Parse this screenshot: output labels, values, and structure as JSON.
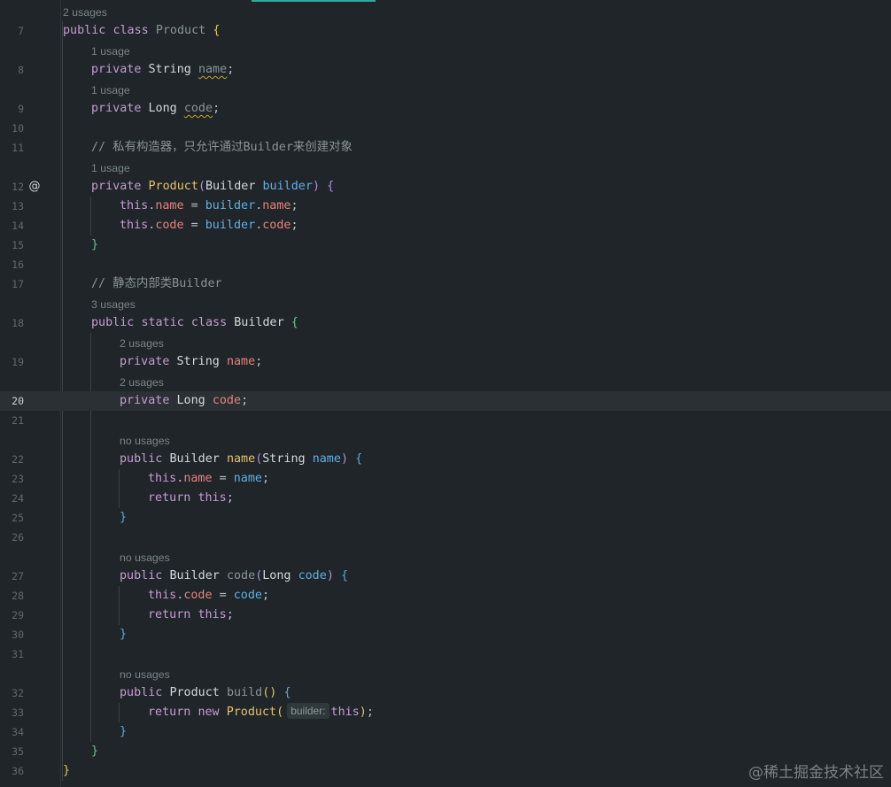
{
  "usage_hints": {
    "u_product_class": "2 usages",
    "u_name_field": "1 usage",
    "u_code_field": "1 usage",
    "u_constructor": "1 usage",
    "u_builder_class": "3 usages",
    "u_builder_name": "2 usages",
    "u_builder_code": "2 usages",
    "u_name_method": "no usages",
    "u_code_method": "no usages",
    "u_build_method": "no usages"
  },
  "line_numbers": {
    "l7": "7",
    "l8": "8",
    "l9": "9",
    "l10": "10",
    "l11": "11",
    "l12": "12",
    "l13": "13",
    "l14": "14",
    "l15": "15",
    "l16": "16",
    "l17": "17",
    "l18": "18",
    "l19": "19",
    "l20": "20",
    "l21": "21",
    "l22": "22",
    "l23": "23",
    "l24": "24",
    "l25": "25",
    "l26": "26",
    "l27": "27",
    "l28": "28",
    "l29": "29",
    "l30": "30",
    "l31": "31",
    "l32": "32",
    "l33": "33",
    "l34": "34",
    "l35": "35",
    "l36": "36"
  },
  "code": {
    "public": "public",
    "private": "private",
    "static": "static",
    "class": "class",
    "this": "this",
    "return": "return",
    "new": "new",
    "Product": "Product",
    "Builder": "Builder",
    "String": "String",
    "Long": "Long",
    "name": "name",
    "code": "code",
    "builder": "builder",
    "build": "build",
    "comment_constructor": "// 私有构造器，只允许通过Builder来创建对象",
    "comment_inner": "// 静态内部类Builder",
    "param_hint": "builder:"
  },
  "gutter": {
    "override_icon": "@"
  },
  "watermark": "@稀土掘金技术社区",
  "colors": {
    "background": "#1f2528",
    "current_line": "#2a3033",
    "keyword": "#c89ad6",
    "field": "#e6837c",
    "parameter": "#5fb0e8",
    "function": "#e8c06f",
    "comment": "#8a9499",
    "accent": "#2fa9a2"
  }
}
